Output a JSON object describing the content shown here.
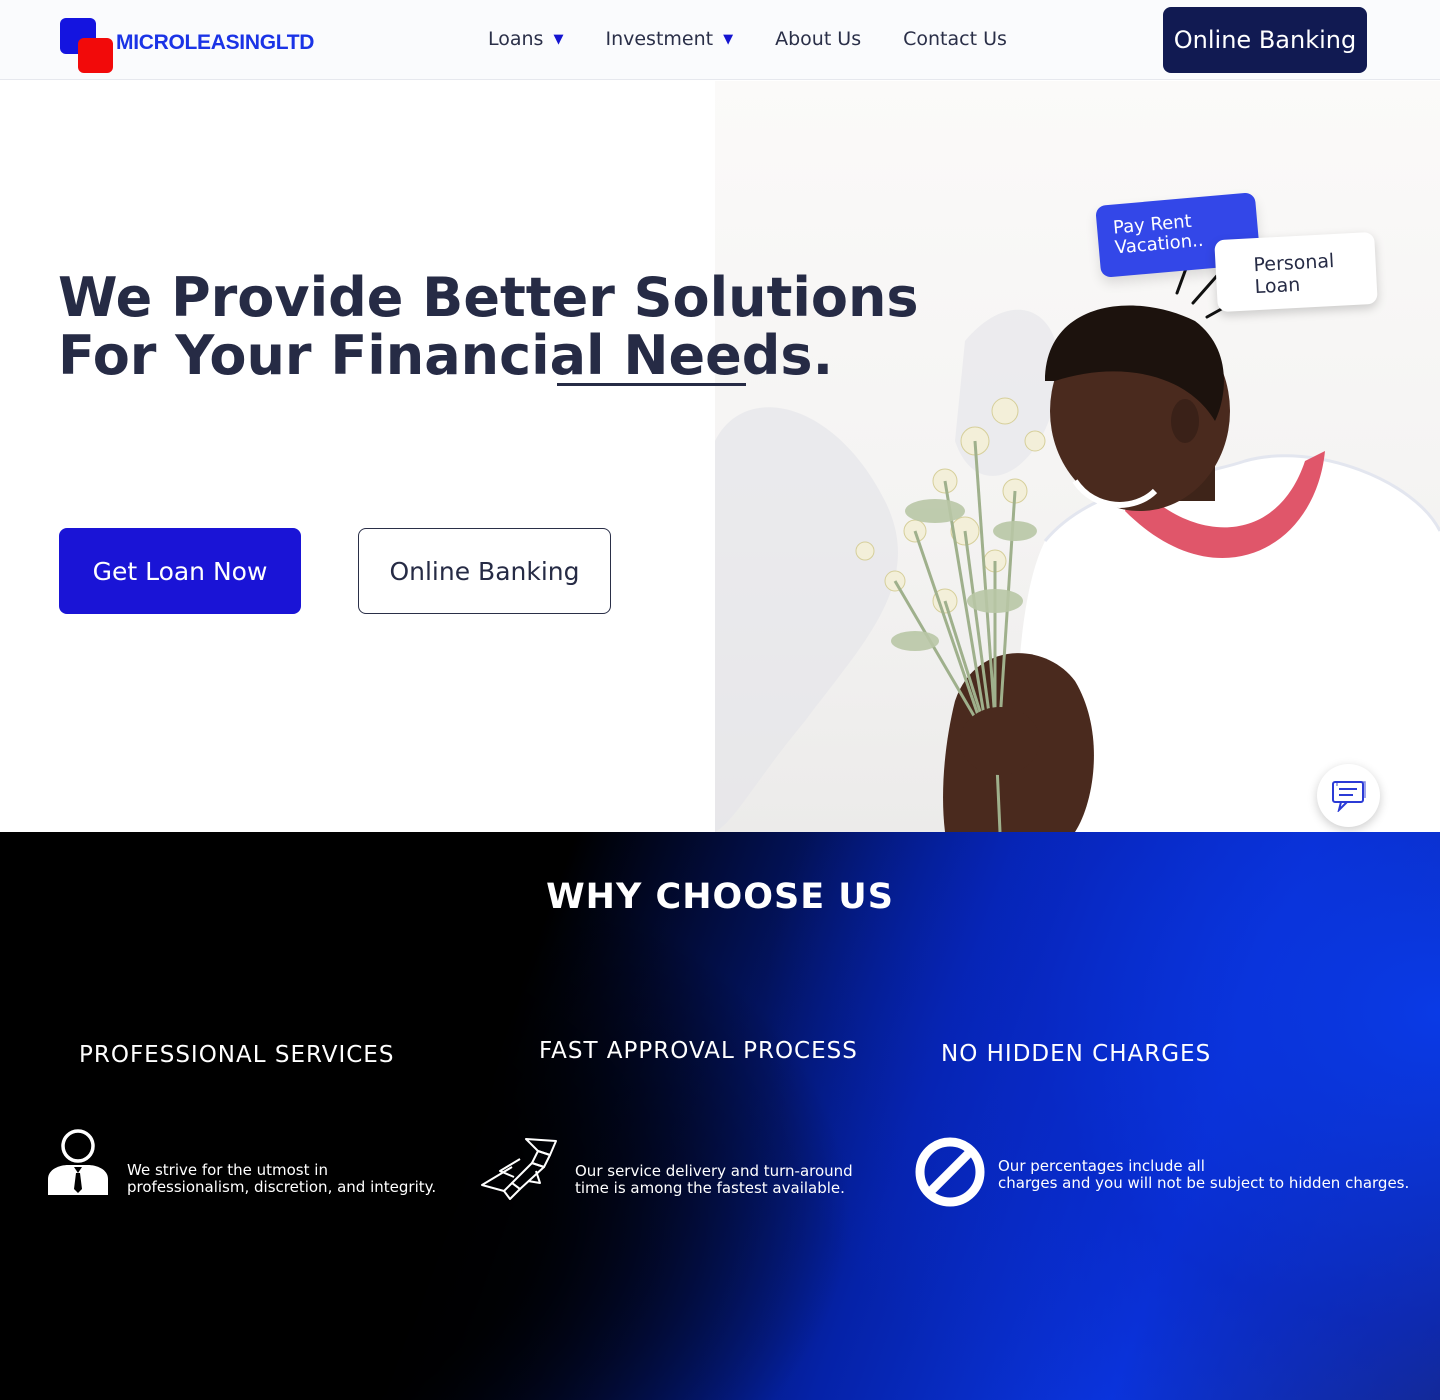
{
  "nav": {
    "logo_text": "MICROLEASINGLTD",
    "menu": [
      {
        "label": "Loans",
        "has_dropdown": true
      },
      {
        "label": "Investment",
        "has_dropdown": true
      },
      {
        "label": "About Us",
        "has_dropdown": false
      },
      {
        "label": "Contact Us",
        "has_dropdown": false
      }
    ],
    "caret": "▼",
    "cta_label": "Online Banking"
  },
  "hero": {
    "title_line1": "We Provide Better Solutions",
    "title_line2": "For Your Financial Needs.",
    "primary_button": "Get Loan Now",
    "secondary_button": "Online Banking",
    "tag_blue_line1": "Pay Rent",
    "tag_blue_line2": "Vacation..",
    "tag_white_line1": "Personal",
    "tag_white_line2": "Loan",
    "chat_icon": "chat-icon"
  },
  "why": {
    "title": "WHY CHOOSE US",
    "features": [
      {
        "title": "PROFESSIONAL SERVICES",
        "text_line1": "We strive for the utmost in",
        "text_line2": "professionalism, discretion, and integrity.",
        "icon": "businessman-icon"
      },
      {
        "title": "FAST APPROVAL PROCESS",
        "text_line1": "Our service delivery and turn-around",
        "text_line2": "time is among the fastest available.",
        "icon": "rocket-icon"
      },
      {
        "title": "NO HIDDEN CHARGES",
        "text_line1": "Our percentages include all",
        "text_line2": "charges and you will not be subject to hidden charges.",
        "icon": "no-symbol-icon"
      }
    ]
  },
  "colors": {
    "brand_blue": "#1a14d6",
    "navy": "#111a52",
    "logo_red": "#f20a0a",
    "text_dark": "#262b45"
  }
}
